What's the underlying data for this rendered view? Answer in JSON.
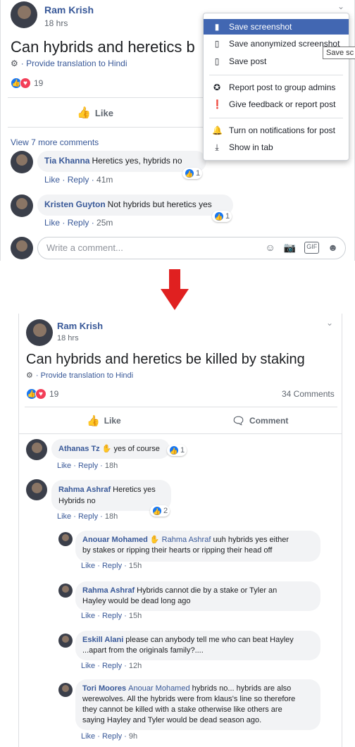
{
  "top": {
    "post": {
      "author": "Ram Krish",
      "time": "18 hrs",
      "title": "Can hybrids and heretics b",
      "translation": "Provide translation to Hindi",
      "reaction_count": "19",
      "like_label": "Like"
    },
    "more_comments": "View 7 more comments",
    "comments": [
      {
        "name": "Tia Khanna",
        "text": "Heretics yes, hybrids no",
        "like": "Like",
        "reply": "Reply",
        "time": "41m",
        "reactions": "1"
      },
      {
        "name": "Kristen Guyton",
        "text": "Not hybrids but heretics yes",
        "like": "Like",
        "reply": "Reply",
        "time": "25m",
        "reactions": "1"
      }
    ],
    "write_placeholder": "Write a comment...",
    "menu": {
      "items": [
        "Save screenshot",
        "Save anonymized screenshot",
        "Save post",
        "Report post to group admins",
        "Give feedback or report post",
        "Turn on notifications for post",
        "Show in tab"
      ],
      "tooltip": "Save sc"
    }
  },
  "bottom": {
    "post": {
      "author": "Ram Krish",
      "time": "18 hrs",
      "title": "Can hybrids and heretics be killed by staking",
      "translation": "Provide translation to Hindi",
      "reaction_count": "19",
      "comment_count": "34 Comments",
      "like_label": "Like",
      "comment_label": "Comment"
    },
    "comments": [
      {
        "name": "Athanas Tz",
        "text": "yes of course",
        "like": "Like",
        "reply": "Reply",
        "time": "18h",
        "reactions": "1"
      },
      {
        "name": "Rahma Ashraf",
        "text": "Heretics yes",
        "text2": "Hybrids no",
        "like": "Like",
        "reply": "Reply",
        "time": "18h",
        "reactions": "2"
      }
    ],
    "replies": [
      {
        "name": "Anouar Mohamed",
        "tag": "Rahma Ashraf",
        "line1": "uuh hybrids yes either",
        "line2": "by stakes or ripping their hearts or ripping their head off",
        "like": "Like",
        "reply": "Reply",
        "time": "15h"
      },
      {
        "name": "Rahma Ashraf",
        "line1": "Hybrids cannot die by a stake or Tyler an",
        "line2": "Hayley would be dead long ago",
        "like": "Like",
        "reply": "Reply",
        "time": "15h"
      },
      {
        "name": "Eskill Alani",
        "line1": "please can anybody tell me who can beat Hayley",
        "line2": "...apart from the originals family?....",
        "like": "Like",
        "reply": "Reply",
        "time": "12h"
      },
      {
        "name": "Tori Moores",
        "tag": "Anouar Mohamed",
        "line1": "hybrids no... hybrids are also",
        "line2": "werewolves. All the hybrids were from klaus's line so therefore",
        "line3": "they cannot be killed with a stake otherwise like others are",
        "line4": "saying Hayley and Tyler would be dead season ago.",
        "like": "Like",
        "reply": "Reply",
        "time": "9h"
      }
    ]
  },
  "colors": {
    "link": "#385898",
    "accent": "#4267b2",
    "arrow": "#e02020",
    "like": "#1877f2",
    "love": "#f33e58"
  }
}
